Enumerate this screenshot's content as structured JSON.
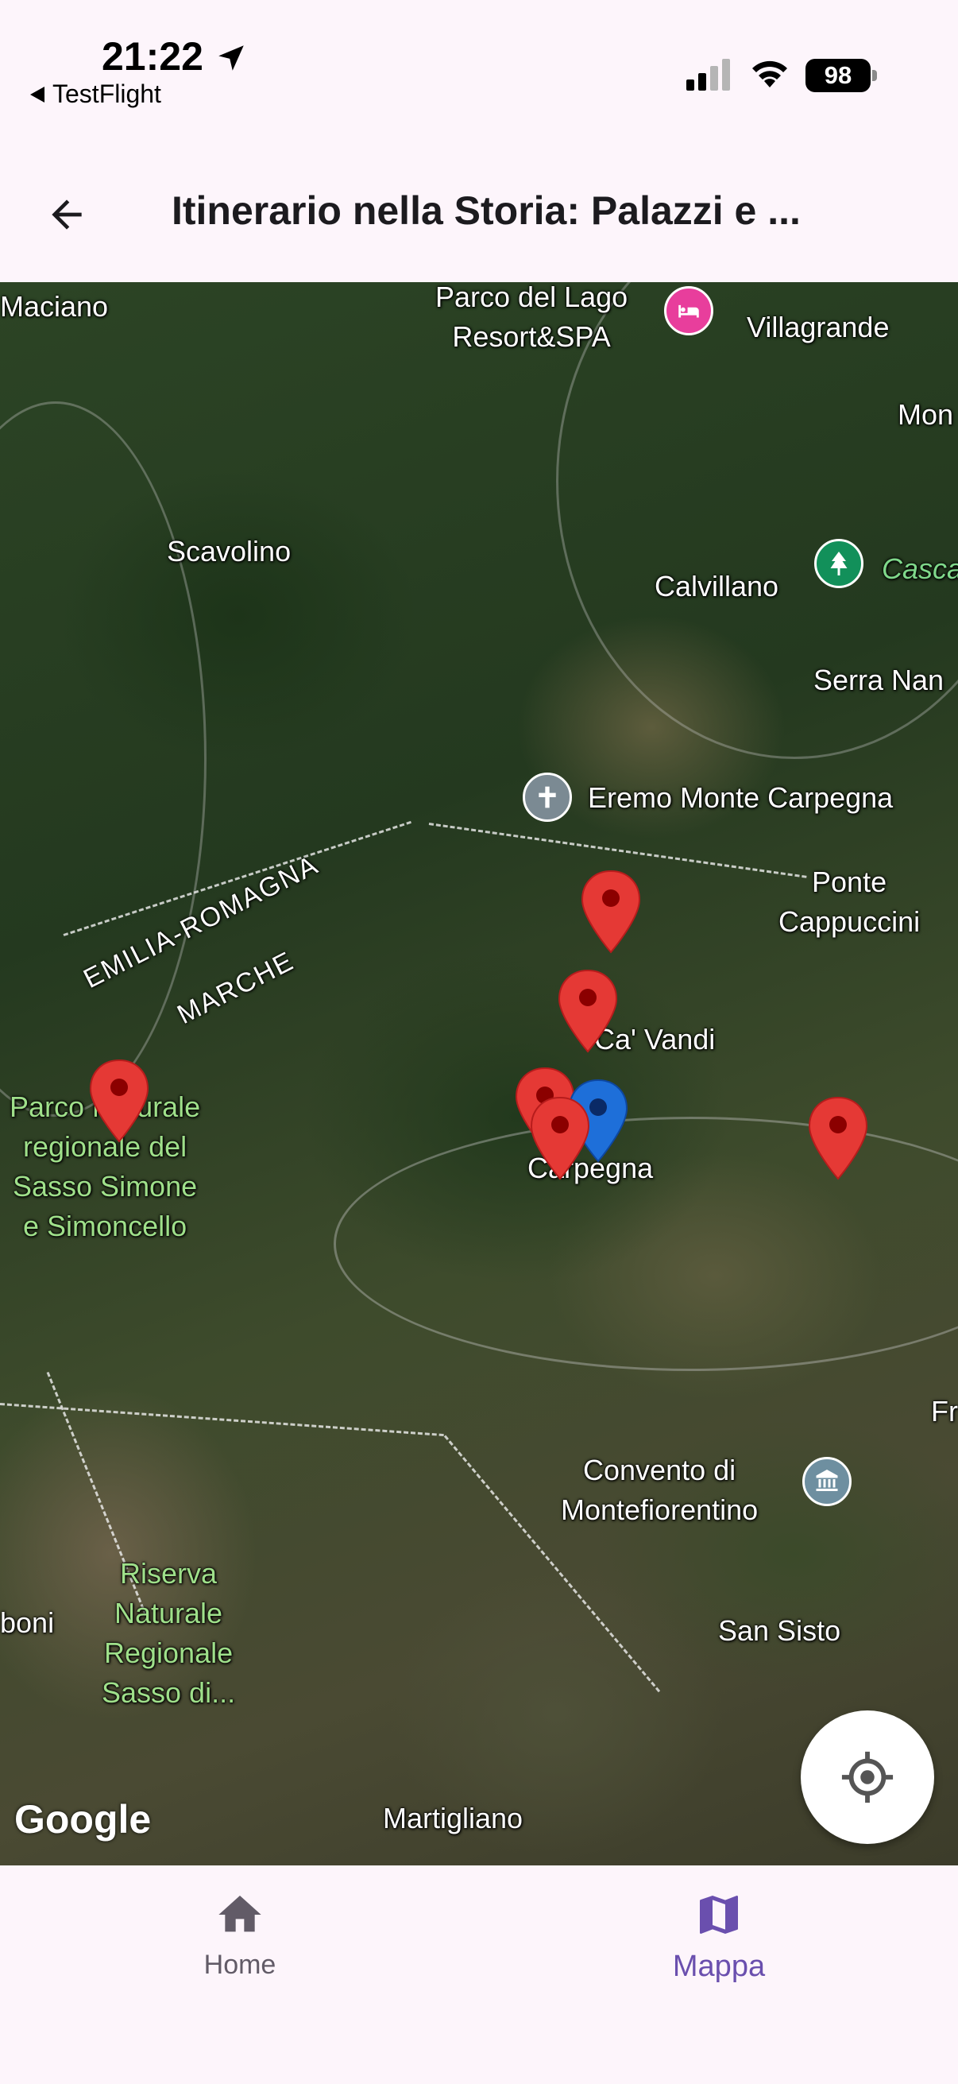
{
  "status_bar": {
    "time": "21:22",
    "back_app": "TestFlight",
    "battery": "98"
  },
  "app_bar": {
    "title": "Itinerario nella Storia: Palazzi e ..."
  },
  "map": {
    "labels": {
      "maciano": "Maciano",
      "parco_lago_1": "Parco del Lago",
      "parco_lago_2": "Resort&SPA",
      "villagrande": "Villagrande",
      "mon": "Mon",
      "scavolino": "Scavolino",
      "calvillano": "Calvillano",
      "casca": "Casca",
      "serra_nan": "Serra Nan",
      "eremo": "Eremo Monte Carpegna",
      "ponte_1": "Ponte",
      "ponte_2": "Cappuccini",
      "emilia": "EMILIA-ROMAGNA",
      "marche": "MARCHE",
      "ca_vandi": "Ca' Vandi",
      "carpegna": "Carpegna",
      "parco_1": "Parco Naturale",
      "parco_2": "regionale del",
      "parco_3": "Sasso Simone",
      "parco_4": "e Simoncello",
      "fr": "Fr",
      "convento_1": "Convento di",
      "convento_2": "Montefiorentino",
      "riserva_1": "Riserva",
      "riserva_2": "Naturale",
      "riserva_3": "Regionale",
      "riserva_4": "Sasso di...",
      "boni": "boni",
      "san_sisto": "San Sisto",
      "martigliano": "Martigliano"
    },
    "google_logo": "Google",
    "colors": {
      "pin_red": "#e53935",
      "pin_blue": "#1e6fd9",
      "hotel_poi": "#e83e9c",
      "park_poi": "#12905a",
      "church_poi": "#7b8a93",
      "museum_poi": "#6e8fa0"
    }
  },
  "bottom_nav": {
    "home_label": "Home",
    "map_label": "Mappa",
    "active": "Mappa",
    "accent": "#6a4fae"
  }
}
